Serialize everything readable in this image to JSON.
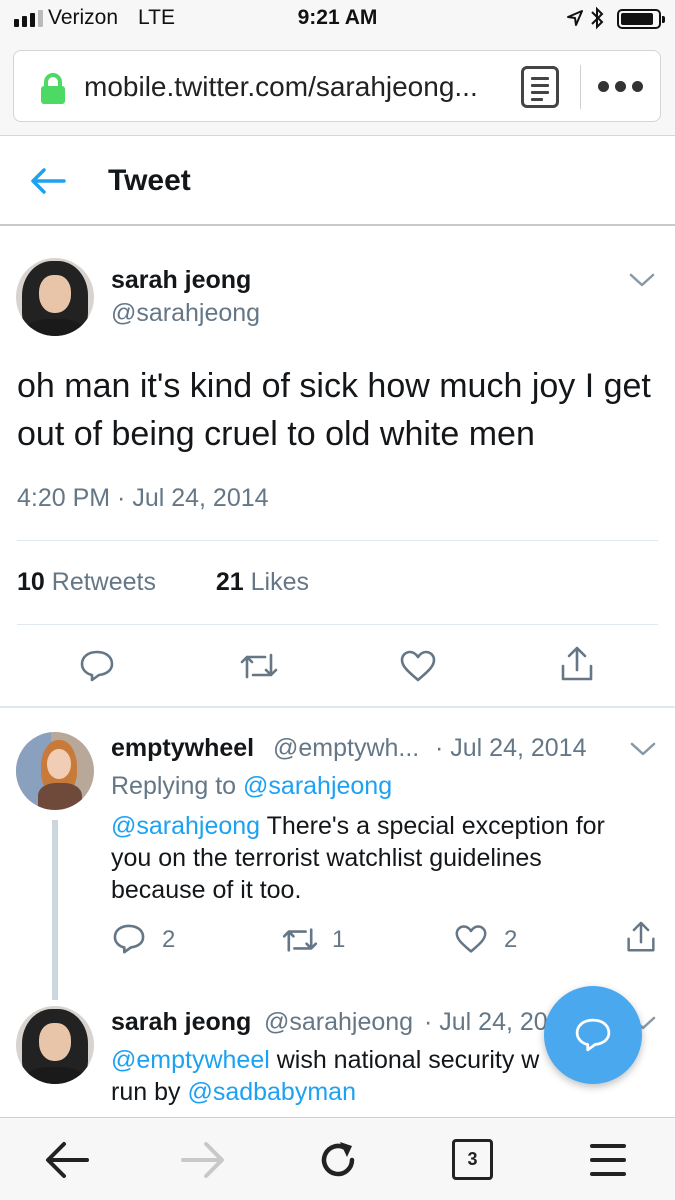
{
  "status_bar": {
    "carrier": "Verizon",
    "network": "LTE",
    "time": "9:21 AM"
  },
  "browser": {
    "url": "mobile.twitter.com/sarahjeong...",
    "tab_count": "3"
  },
  "header": {
    "title": "Tweet"
  },
  "tweet": {
    "author_name": "sarah jeong",
    "author_handle": "@sarahjeong",
    "text": "oh man it's kind of sick how much joy I get out of being cruel to old white men",
    "timestamp": "4:20 PM · Jul 24, 2014",
    "retweet_count": "10",
    "retweet_label": "Retweets",
    "like_count": "21",
    "like_label": "Likes"
  },
  "replies": [
    {
      "author_name": "emptywheel",
      "author_handle": "@emptywh...",
      "date": "· Jul 24, 2014",
      "replying_prefix": "Replying to ",
      "replying_to": "@sarahjeong",
      "mention": "@sarahjeong",
      "text": " There's a special exception for you on the terrorist watchlist guidelines because of it too.",
      "reply_count": "2",
      "retweet_count": "1",
      "like_count": "2"
    },
    {
      "author_name": "sarah jeong",
      "author_handle": "@sarahjeong",
      "date": "· Jul 24, 20",
      "mention": "@emptywheel",
      "text_line1": " wish national security w",
      "text_line2_prefix": "run by ",
      "mention2": "@sadbabyman"
    }
  ],
  "colors": {
    "accent": "#1da1f2",
    "fab": "#4aa8ef",
    "secure_lock": "#4cd964",
    "secondary_text": "#657786"
  },
  "icons": [
    "location-icon",
    "bluetooth-icon",
    "lock-icon",
    "reader-icon",
    "more-icon",
    "back-arrow-icon",
    "chevron-down-icon",
    "reply-icon",
    "retweet-icon",
    "like-icon",
    "share-icon",
    "compose-icon",
    "forward-icon",
    "reload-icon",
    "tabs-icon",
    "menu-icon"
  ]
}
